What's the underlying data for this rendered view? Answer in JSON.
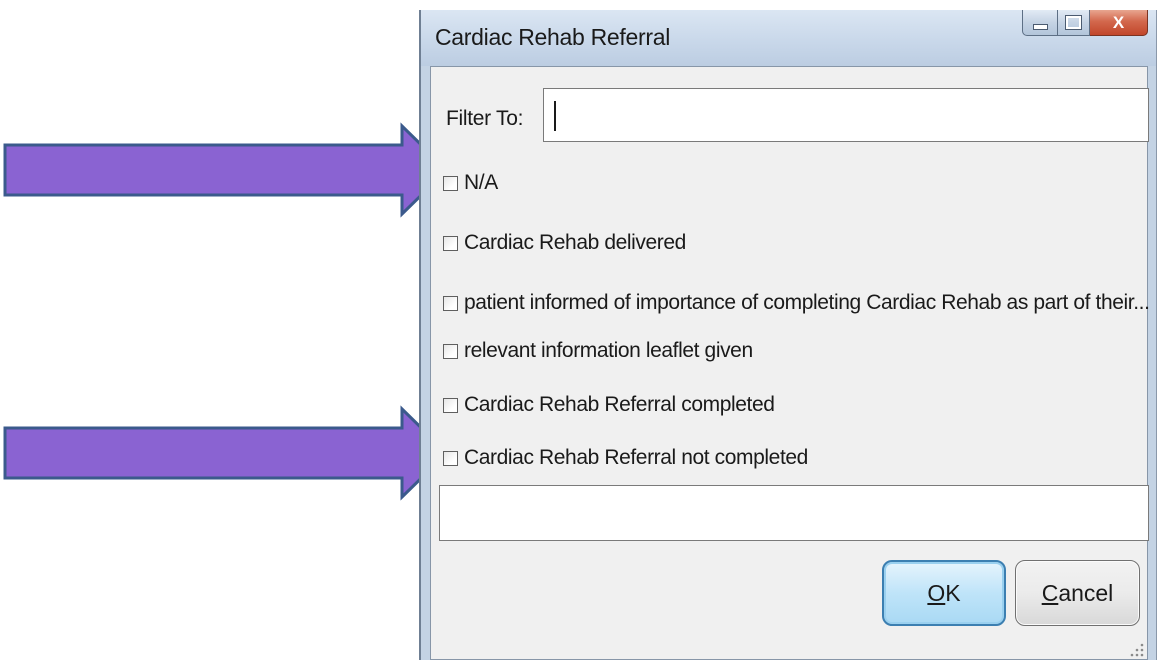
{
  "window": {
    "title": "Cardiac Rehab Referral",
    "controls": {
      "minimize_icon": "minimize-icon",
      "maximize_icon": "maximize-icon",
      "close_label": "X"
    }
  },
  "filter": {
    "label": "Filter To:",
    "value": "",
    "placeholder": ""
  },
  "options": [
    {
      "label": "N/A",
      "checked": false
    },
    {
      "label": "Cardiac Rehab delivered",
      "checked": false
    },
    {
      "label": "patient informed of importance of completing Cardiac Rehab as part of their...",
      "checked": false
    },
    {
      "label": "relevant information leaflet given",
      "checked": false
    },
    {
      "label": "Cardiac Rehab Referral completed",
      "checked": false
    },
    {
      "label": "Cardiac Rehab Referral  not completed",
      "checked": false
    }
  ],
  "free_text": {
    "value": ""
  },
  "buttons": {
    "ok": {
      "accel": "O",
      "rest": "K"
    },
    "cancel": {
      "accel": "C",
      "rest": "ancel"
    }
  },
  "annotations": {
    "arrow_color": "#8a63d2",
    "arrow_border": "#3b5a8c",
    "targets": [
      "N/A",
      "Cardiac Rehab Referral  not completed"
    ]
  },
  "colors": {
    "window_frame": "#c4d3e4",
    "client_bg": "#f0f0f0",
    "ok_button": "#bfe4f9",
    "close_button": "#d3684d"
  }
}
